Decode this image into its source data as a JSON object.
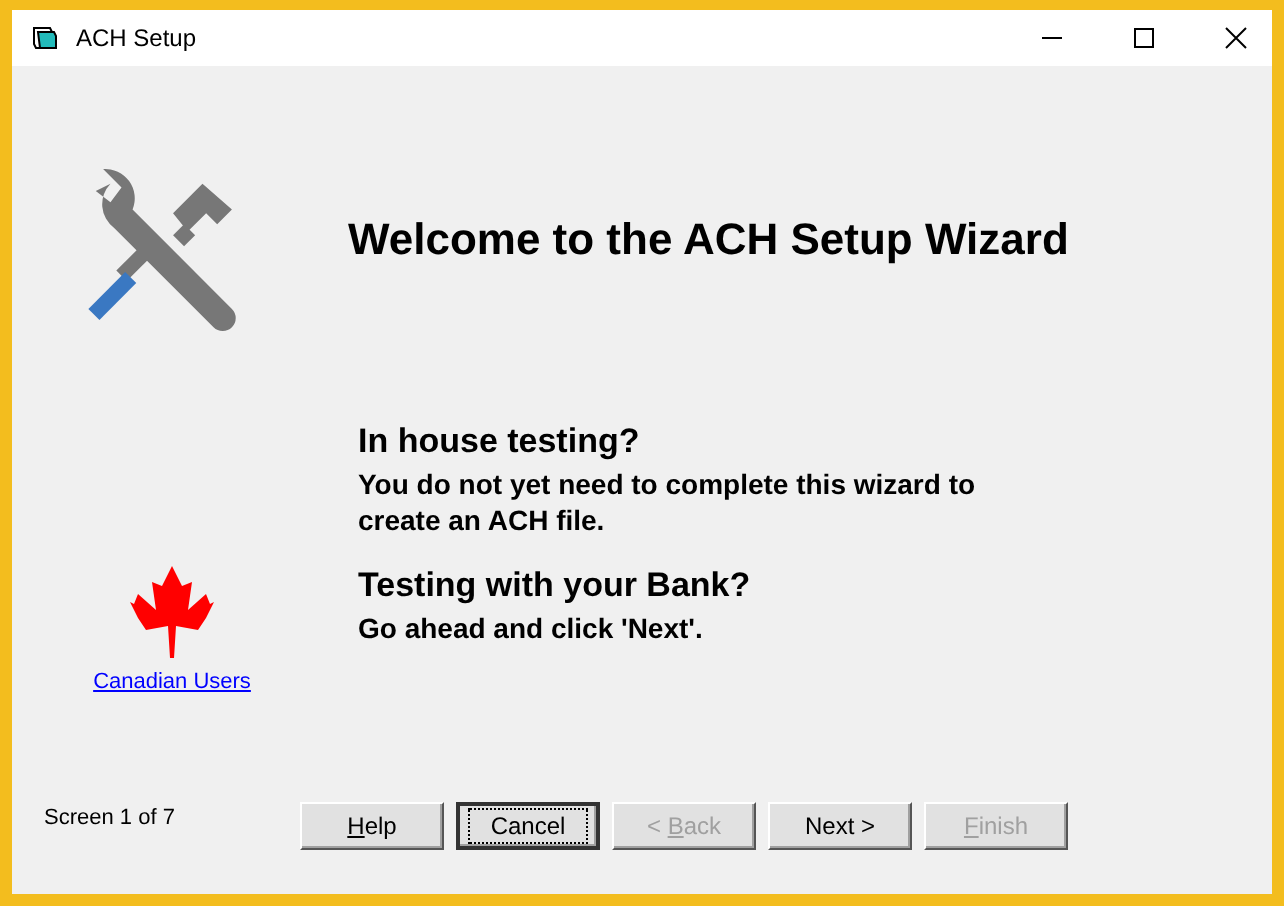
{
  "window": {
    "title": "ACH Setup"
  },
  "heading": "Welcome to the ACH Setup Wizard",
  "sections": [
    {
      "title": "In house testing?",
      "body": "You do not yet need to complete this wizard to create an ACH file."
    },
    {
      "title": "Testing with your Bank?",
      "body": "Go ahead and click 'Next'."
    }
  ],
  "link": "Canadian Users",
  "status": "Screen 1 of 7",
  "buttons": [
    {
      "label": "Help",
      "access_key": true,
      "disabled": false,
      "focused": false
    },
    {
      "label": "Cancel",
      "disabled": false,
      "focused": true
    },
    {
      "label": "< Back",
      "access_key": true,
      "disabled": true,
      "focused": false
    },
    {
      "label": "Next >",
      "disabled": false,
      "focused": false
    },
    {
      "label": "Finish",
      "access_key": true,
      "disabled": true,
      "focused": false
    }
  ]
}
